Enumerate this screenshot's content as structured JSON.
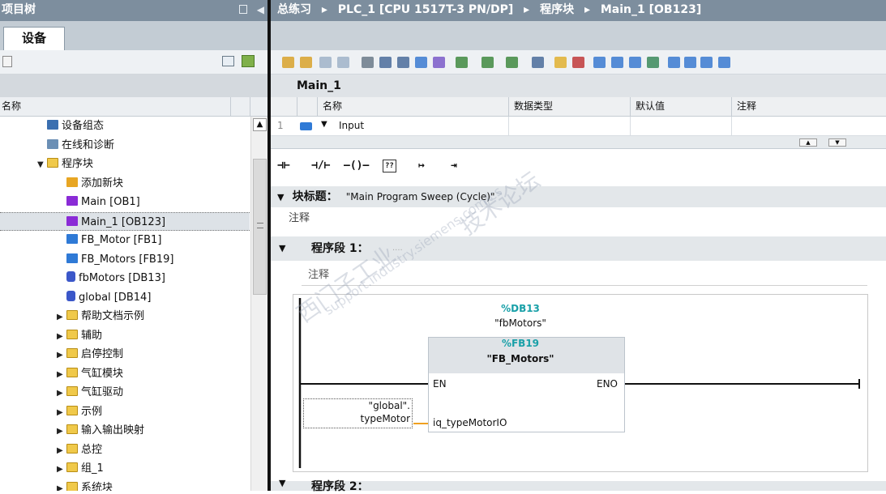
{
  "left_panel": {
    "title": "项目树",
    "tab_label": "设备",
    "column_header": "名称",
    "tree_items": [
      {
        "label": "设备组态",
        "icon": "device-config-icon",
        "indent": 1,
        "toggle": ""
      },
      {
        "label": "在线和诊断",
        "icon": "online-diagnostics-icon",
        "indent": 1,
        "toggle": ""
      },
      {
        "label": "程序块",
        "icon": "program-blocks-folder-icon",
        "indent": 1,
        "toggle": "▼"
      },
      {
        "label": "添加新块",
        "icon": "add-block-icon",
        "indent": 2,
        "toggle": ""
      },
      {
        "label": "Main [OB1]",
        "icon": "ob-block-icon",
        "indent": 2,
        "toggle": ""
      },
      {
        "label": "Main_1 [OB123]",
        "icon": "ob-block-icon",
        "indent": 2,
        "toggle": "",
        "selected": true
      },
      {
        "label": "FB_Motor [FB1]",
        "icon": "fb-block-icon",
        "indent": 2,
        "toggle": ""
      },
      {
        "label": "FB_Motors [FB19]",
        "icon": "fb-block-icon",
        "indent": 2,
        "toggle": ""
      },
      {
        "label": "fbMotors [DB13]",
        "icon": "db-block-icon",
        "indent": 2,
        "toggle": ""
      },
      {
        "label": "global [DB14]",
        "icon": "db-block-icon",
        "indent": 2,
        "toggle": ""
      },
      {
        "label": "帮助文档示例",
        "icon": "folder-icon",
        "indent": 2,
        "toggle": "▶"
      },
      {
        "label": "辅助",
        "icon": "folder-icon",
        "indent": 2,
        "toggle": "▶"
      },
      {
        "label": "启停控制",
        "icon": "folder-icon",
        "indent": 2,
        "toggle": "▶"
      },
      {
        "label": "气缸模块",
        "icon": "folder-icon",
        "indent": 2,
        "toggle": "▶"
      },
      {
        "label": "气缸驱动",
        "icon": "folder-icon",
        "indent": 2,
        "toggle": "▶"
      },
      {
        "label": "示例",
        "icon": "folder-icon",
        "indent": 2,
        "toggle": "▶"
      },
      {
        "label": "输入输出映射",
        "icon": "folder-icon",
        "indent": 2,
        "toggle": "▶"
      },
      {
        "label": "总控",
        "icon": "folder-icon",
        "indent": 2,
        "toggle": "▶"
      },
      {
        "label": "组_1",
        "icon": "folder-icon",
        "indent": 2,
        "toggle": "▶"
      },
      {
        "label": "系统块",
        "icon": "folder-icon",
        "indent": 2,
        "toggle": "▶"
      }
    ]
  },
  "breadcrumb": {
    "items": [
      "总练习",
      "PLC_1 [CPU 1517T-3 PN/DP]",
      "程序块",
      "Main_1 [OB123]"
    ],
    "separator": "▸"
  },
  "editor": {
    "block_name": "Main_1",
    "interface_columns": [
      "名称",
      "数据类型",
      "默认值",
      "注释"
    ],
    "interface_row": {
      "index": "1",
      "name": "Input"
    },
    "ladder_buttons": [
      "⊣⊢",
      "⊣/⊢",
      "–()–",
      "??",
      "↦",
      "⇥"
    ],
    "block_title_label": "块标题：",
    "block_title_value": "\"Main Program Sweep (Cycle)\"",
    "comment_placeholder": "注释",
    "network1_label": "程序段 1：",
    "network1_ellipsis": "....",
    "network2_label": "程序段 2：",
    "fb_instance_address": "%DB13",
    "fb_instance_name": "\"fbMotors\"",
    "fb_type_address": "%FB19",
    "fb_type_name": "\"FB_Motors\"",
    "en_label": "EN",
    "eno_label": "ENO",
    "param_name": "iq_typeMotorIO",
    "operand_line1": "\"global\".",
    "operand_line2": "typeMotor"
  },
  "watermark": {
    "line1": "西门子工业",
    "line2": "support.industry.siemens.com/cs",
    "line3": "技术论坛"
  },
  "colors": {
    "title_bar": "#7d8e9e",
    "teal_address": "#19a0a8",
    "box_fill": "#dfe3e7",
    "wire_orange": "#f0a020"
  }
}
